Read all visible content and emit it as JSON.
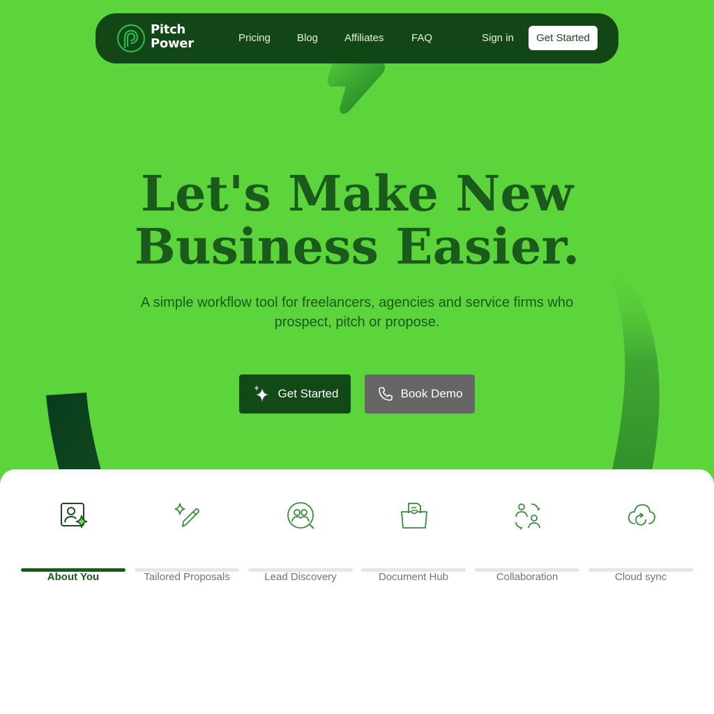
{
  "brand": {
    "name_line1": "Pitch",
    "name_line2": "Power",
    "logo_icon": "concentric-p-logo-icon"
  },
  "nav": {
    "links": [
      "Pricing",
      "Blog",
      "Affiliates",
      "FAQ"
    ],
    "sign_in": "Sign in",
    "get_started": "Get Started"
  },
  "hero": {
    "headline_line1": "Let's Make New",
    "headline_line2": "Business Easier.",
    "subhead": "A simple workflow tool for freelancers, agencies and service firms who prospect, pitch or propose.",
    "primary_cta": "Get Started",
    "primary_icon": "sparkle-icon",
    "secondary_cta": "Book Demo",
    "secondary_icon": "phone-icon"
  },
  "features": {
    "tabs": [
      {
        "label": "About You",
        "icon": "profile-sparkle-icon",
        "active": true
      },
      {
        "label": "Tailored Proposals",
        "icon": "pencil-sparkle-icon",
        "active": false
      },
      {
        "label": "Lead Discovery",
        "icon": "people-search-icon",
        "active": false
      },
      {
        "label": "Document Hub",
        "icon": "document-tray-icon",
        "active": false
      },
      {
        "label": "Collaboration",
        "icon": "collaboration-icon",
        "active": false
      },
      {
        "label": "Cloud sync",
        "icon": "cloud-sync-icon",
        "active": false
      }
    ]
  },
  "colors": {
    "hero_bg": "#5cd43b",
    "navbar_bg": "#134616",
    "headline": "#1a5a1b",
    "primary_button": "#124a17",
    "secondary_button": "#666666",
    "active_tab": "#19591c",
    "inactive_tab_bar": "#e6e6e6"
  }
}
